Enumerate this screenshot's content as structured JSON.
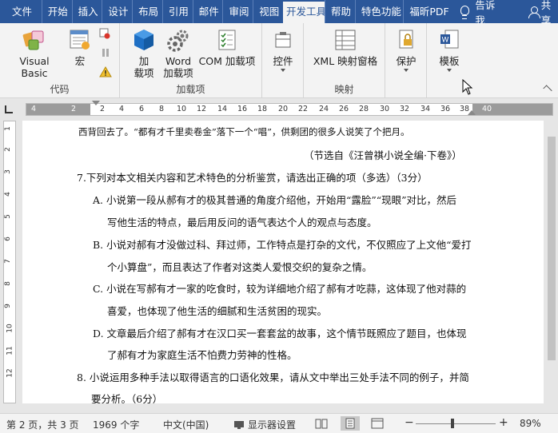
{
  "tabs": [
    "文件",
    "开始",
    "插入",
    "设计",
    "布局",
    "引用",
    "邮件",
    "审阅",
    "视图",
    "开发工具",
    "帮助",
    "特色功能",
    "福昕PDF"
  ],
  "tell_me": "告诉我",
  "share": "共享",
  "ribbon": {
    "code_group": "代码",
    "visual_basic": "Visual Basic",
    "macro": "宏",
    "addins_group": "加载项",
    "addins": "加\n载项",
    "addins_1": "加",
    "addins_2": "载项",
    "word_addins_1": "Word",
    "word_addins_2": "加载项",
    "com_addins": "COM 加载项",
    "controls": "控件",
    "xml_pane": "XML 映射窗格",
    "mapping_group": "映射",
    "protect": "保护",
    "template": "模板"
  },
  "ruler_nums": [
    "4",
    "2",
    "2",
    "4",
    "6",
    "8",
    "10",
    "12",
    "14",
    "16",
    "18",
    "20",
    "22",
    "24",
    "26",
    "28",
    "30",
    "32",
    "34",
    "36",
    "38",
    "40"
  ],
  "vruler_nums": [
    "1",
    "2",
    "3",
    "4",
    "5",
    "6",
    "7",
    "8",
    "9",
    "10",
    "11",
    "12"
  ],
  "doc": {
    "l1": "西背回去了。“都有才千里卖卷金”落下一个“唱”，供剩团的很多人说笑了个把月。",
    "l2": "（节选自《汪曾祺小说全编·下卷》）",
    "l3": "7.下列对本文相关内容和艺术特色的分析鉴赏，请选出正确的项（多选）（3分）",
    "l4": "A.  小说第一段从郝有才的极其普通的角度介绍他，开始用“露脸”“现眼”对比，然后",
    "l5": "写他生活的特点，最后用反问的语气表达个人的观点与态度。",
    "l6": "B.  小说对郝有才没做过科、拜过师，工作特点是打杂的文代，不仅照应了上文他“爱打",
    "l7": "个小算盘”，而且表达了作者对这类人爱恨交织的复杂之情。",
    "l8": "C.  小说在写郝有才一家的吃食时，较为详细地介绍了郝有才吃蒜，这体现了他对蒜的",
    "l9": "喜爱，也体现了他生活的细腻和生活贫困的现实。",
    "l10": "D.  文章最后介绍了郝有才在汉口买一套套盆的故事，这个情节既照应了题目，也体现",
    "l11": "了郝有才为家庭生活不怕费力劳神的性格。",
    "l12": "8.  小说运用多种手法以取得语言的口语化效果，请从文中举出三处手法不同的例子，并简",
    "l13": "要分析。（6分）"
  },
  "status": {
    "page": "第 2 页，共 3 页",
    "words": "1969 个字",
    "lang": "中文(中国)",
    "display": "显示器设置",
    "zoom": "89%",
    "minus": "−",
    "plus": "+"
  },
  "colors": {
    "accent": "#2b579a"
  }
}
